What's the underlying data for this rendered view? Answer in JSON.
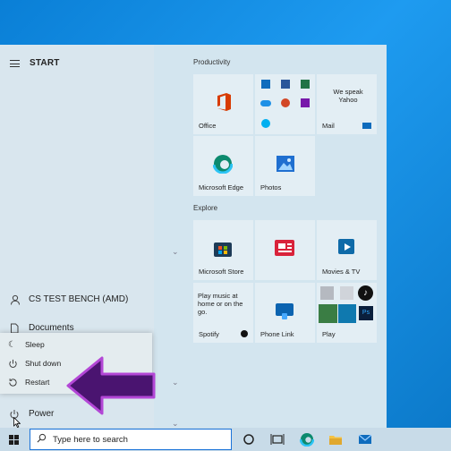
{
  "start_menu": {
    "title": "START",
    "user": "CS TEST BENCH (AMD)",
    "documents": "Documents",
    "power": "Power",
    "power_menu": [
      "Sleep",
      "Shut down",
      "Restart"
    ]
  },
  "groups": {
    "productivity": "Productivity",
    "explore": "Explore"
  },
  "tiles": {
    "office": "Office",
    "mail": "Mail",
    "yahoo_text": "We speak Yahoo",
    "edge": "Microsoft Edge",
    "photos": "Photos",
    "store": "Microsoft Store",
    "news": "",
    "movies": "Movies & TV",
    "spotify_text": "Play music at home or on the go.",
    "spotify": "Spotify",
    "phone_link": "Phone Link",
    "play": "Play"
  },
  "taskbar": {
    "search_placeholder": "Type here to search"
  },
  "colors": {
    "accent_purple": "#7a1fa2",
    "arrow_fill": "#4a1470",
    "search_border": "#1a73d9"
  }
}
